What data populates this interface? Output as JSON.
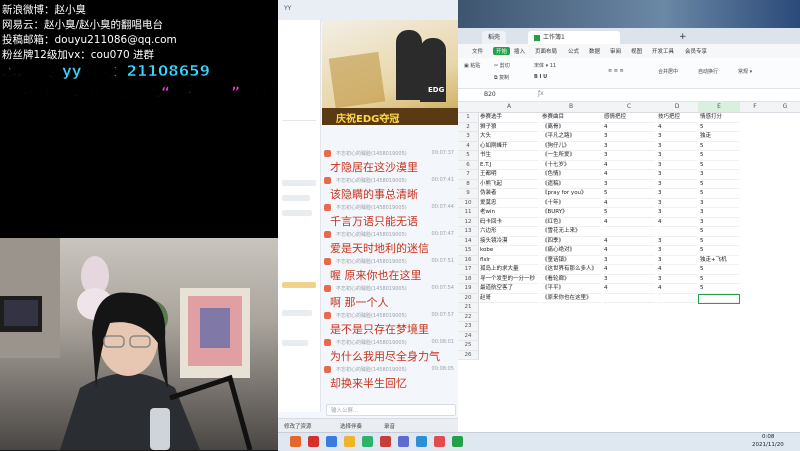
{
  "overlay": {
    "weibo": "新浪微博：赵小臭",
    "netease": "网易云：赵小臭/赵小臭的翻唱电台",
    "email": "投稿邮箱：douyu211086@qq.com",
    "fans": "粉丝牌12级加vx：cou070 进群",
    "yy_channel": "水友歌会yy频道：21108659",
    "instruction": "伴奏可以在酷狗上找 输入“歌名 伴奏”按回车"
  },
  "banner": {
    "text": "庆祝EDG夺冠",
    "team": "EDG"
  },
  "chat": {
    "title": "YY",
    "messages": [
      {
        "user": "不忘初心的臻脸(1458019005)",
        "time": "00:07:37",
        "text": "才隐居在这沙漠里"
      },
      {
        "user": "不忘初心的臻脸(1458019005)",
        "time": "00:07:41",
        "text": "该隐瞒的事总清晰"
      },
      {
        "user": "不忘初心的臻脸(1458019005)",
        "time": "00:07:44",
        "text": "千言万语只能无语"
      },
      {
        "user": "不忘初心的臻脸(1458019005)",
        "time": "00:07:47",
        "text": "爱是天时地利的迷信"
      },
      {
        "user": "不忘初心的臻脸(1458019005)",
        "time": "00:07:51",
        "text": "喔 原来你也在这里"
      },
      {
        "user": "不忘初心的臻脸(1458019005)",
        "time": "00:07:54",
        "text": "啊 那一个人"
      },
      {
        "user": "不忘初心的臻脸(1458019005)",
        "time": "00:07:57",
        "text": "是不是只存在梦境里"
      },
      {
        "user": "不忘初心的臻脸(1458019005)",
        "time": "00:08:01",
        "text": "为什么我用尽全身力气"
      },
      {
        "user": "不忘初心的臻脸(1458019005)",
        "time": "00:08:05",
        "text": "却换来半生回忆"
      }
    ],
    "input_placeholder": "输入公屏...",
    "bottom": [
      "修改了资源",
      "选择伴奏",
      "录音"
    ]
  },
  "sheet": {
    "tabs": [
      "稻壳",
      "工作簿1"
    ],
    "menus": [
      "文件",
      "开始",
      "插入",
      "页面布局",
      "公式",
      "数据",
      "审阅",
      "视图",
      "开发工具",
      "会员专享"
    ],
    "cell_ref": "B20",
    "columns": [
      "A",
      "B",
      "C",
      "D",
      "E",
      "F",
      "G"
    ],
    "headers": [
      "参赛选手",
      "参赛曲目",
      "感情把控",
      "技巧把控",
      "情感打分",
      "",
      ""
    ],
    "rows": [
      [
        "狮子狼",
        "《离骨》",
        "4",
        "4",
        "5"
      ],
      [
        "大头",
        "《平凡之路》",
        "3",
        "3",
        "独走"
      ],
      [
        "心如刚峰开",
        "《狗仔儿》",
        "3",
        "3",
        "5"
      ],
      [
        "书生",
        "《一生所爱》",
        "3",
        "3",
        "5"
      ],
      [
        "E.T.J",
        "《十七岁》",
        "4",
        "3",
        "5"
      ],
      [
        "王都明",
        "《色情》",
        "4",
        "3",
        "3"
      ],
      [
        "小熊飞起",
        "《遗稿》",
        "3",
        "3",
        "5"
      ],
      [
        "伪装者",
        "《pray for you》",
        "5",
        "3",
        "5"
      ],
      [
        "爱莫忠",
        "《十年》",
        "4",
        "3",
        "3"
      ],
      [
        "老win",
        "《BURY》",
        "5",
        "3",
        "3"
      ],
      [
        "码卡回卡",
        "《红色》",
        "4",
        "4",
        "3"
      ],
      [
        "六边形",
        "《雪花无上来》",
        "",
        "",
        "5"
      ],
      [
        "接头镜冷漠",
        "《四季》",
        "4",
        "3",
        "5"
      ],
      [
        "kobe",
        "《痛心绝对》",
        "4",
        "3",
        "5"
      ],
      [
        "flslr",
        "《童话镇》",
        "3",
        "3",
        "独走+飞机"
      ],
      [
        "孤岛上的求大量",
        "《这世界有那么多人》",
        "4",
        "4",
        "5"
      ],
      [
        "寻一个发型的一分一秒",
        "《看轮廊》",
        "3",
        "3",
        "5"
      ],
      [
        "最道航空客了",
        "《平平》",
        "4",
        "4",
        "5"
      ],
      [
        "赵哥",
        "《原来你也在这里》",
        "",
        "",
        ""
      ]
    ]
  },
  "taskbar": {
    "time": "0:08",
    "date": "2021/11/20"
  },
  "colors": {
    "yy_cyan": "#39d7ff",
    "instruction_magenta": "#ff3df0",
    "chat_lyric_red": "#c8341f",
    "sheet_green": "#24a148"
  }
}
